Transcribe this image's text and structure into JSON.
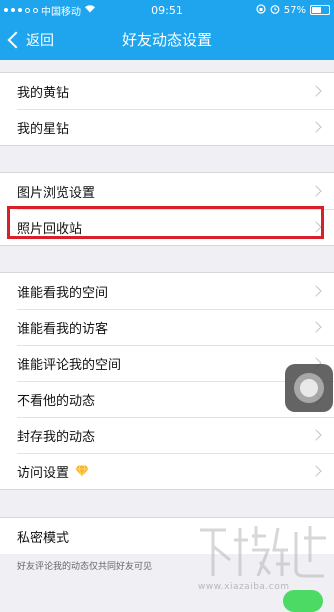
{
  "status_bar": {
    "carrier": "中国移动",
    "time": "09:51",
    "battery": "57%"
  },
  "nav": {
    "back_label": "返回",
    "title": "好友动态设置"
  },
  "groups": [
    {
      "items": [
        {
          "label": "我的黄钻"
        },
        {
          "label": "我的星钻"
        }
      ]
    },
    {
      "items": [
        {
          "label": "图片浏览设置"
        },
        {
          "label": "照片回收站"
        }
      ]
    },
    {
      "items": [
        {
          "label": "谁能看我的空间"
        },
        {
          "label": "谁能看我的访客"
        },
        {
          "label": "谁能评论我的空间"
        },
        {
          "label": "不看他的动态"
        },
        {
          "label": "封存我的动态"
        },
        {
          "label": "访问设置",
          "icon": "yellow-diamond-icon"
        }
      ]
    },
    {
      "items": [
        {
          "label": "私密模式"
        }
      ]
    }
  ],
  "private_mode_note": "好友评论我的动态仅共同好友可见",
  "watermark_site": "www.xiazaiba.com",
  "colors": {
    "nav_bg": "#1fa5ee",
    "highlight": "#d8202a",
    "diamond": "#f7b526"
  }
}
